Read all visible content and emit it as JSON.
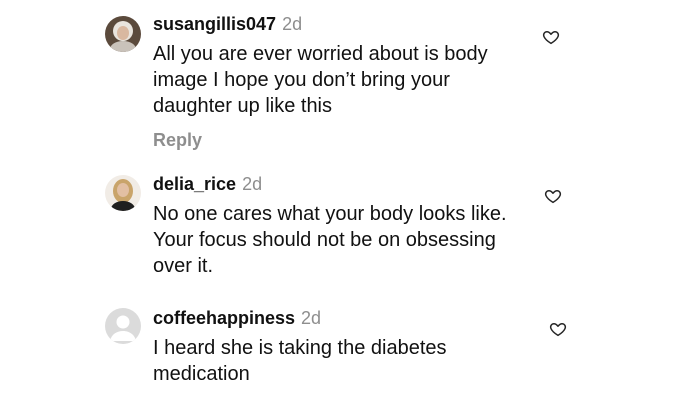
{
  "comments": [
    {
      "username": "susangillis047",
      "time": "2d",
      "text": "All you are ever worried about is body image I hope you don’t bring your daughter up like this",
      "reply_label": "Reply",
      "avatar_icon": "user-photo-avatar",
      "like_icon": "heart-outline-icon"
    },
    {
      "username": "delia_rice",
      "time": "2d",
      "text": "No one cares what your body looks like. Your focus should not be on obsessing over it.",
      "avatar_icon": "user-photo-avatar",
      "like_icon": "heart-outline-icon"
    },
    {
      "username": "coffeehappiness",
      "time": "2d",
      "text": "I heard she is taking the diabetes medication",
      "avatar_icon": "default-avatar",
      "like_icon": "heart-outline-icon"
    }
  ],
  "colors": {
    "text": "#111111",
    "muted": "#8e8e8e",
    "default_avatar_bg": "#dbdbdb"
  }
}
